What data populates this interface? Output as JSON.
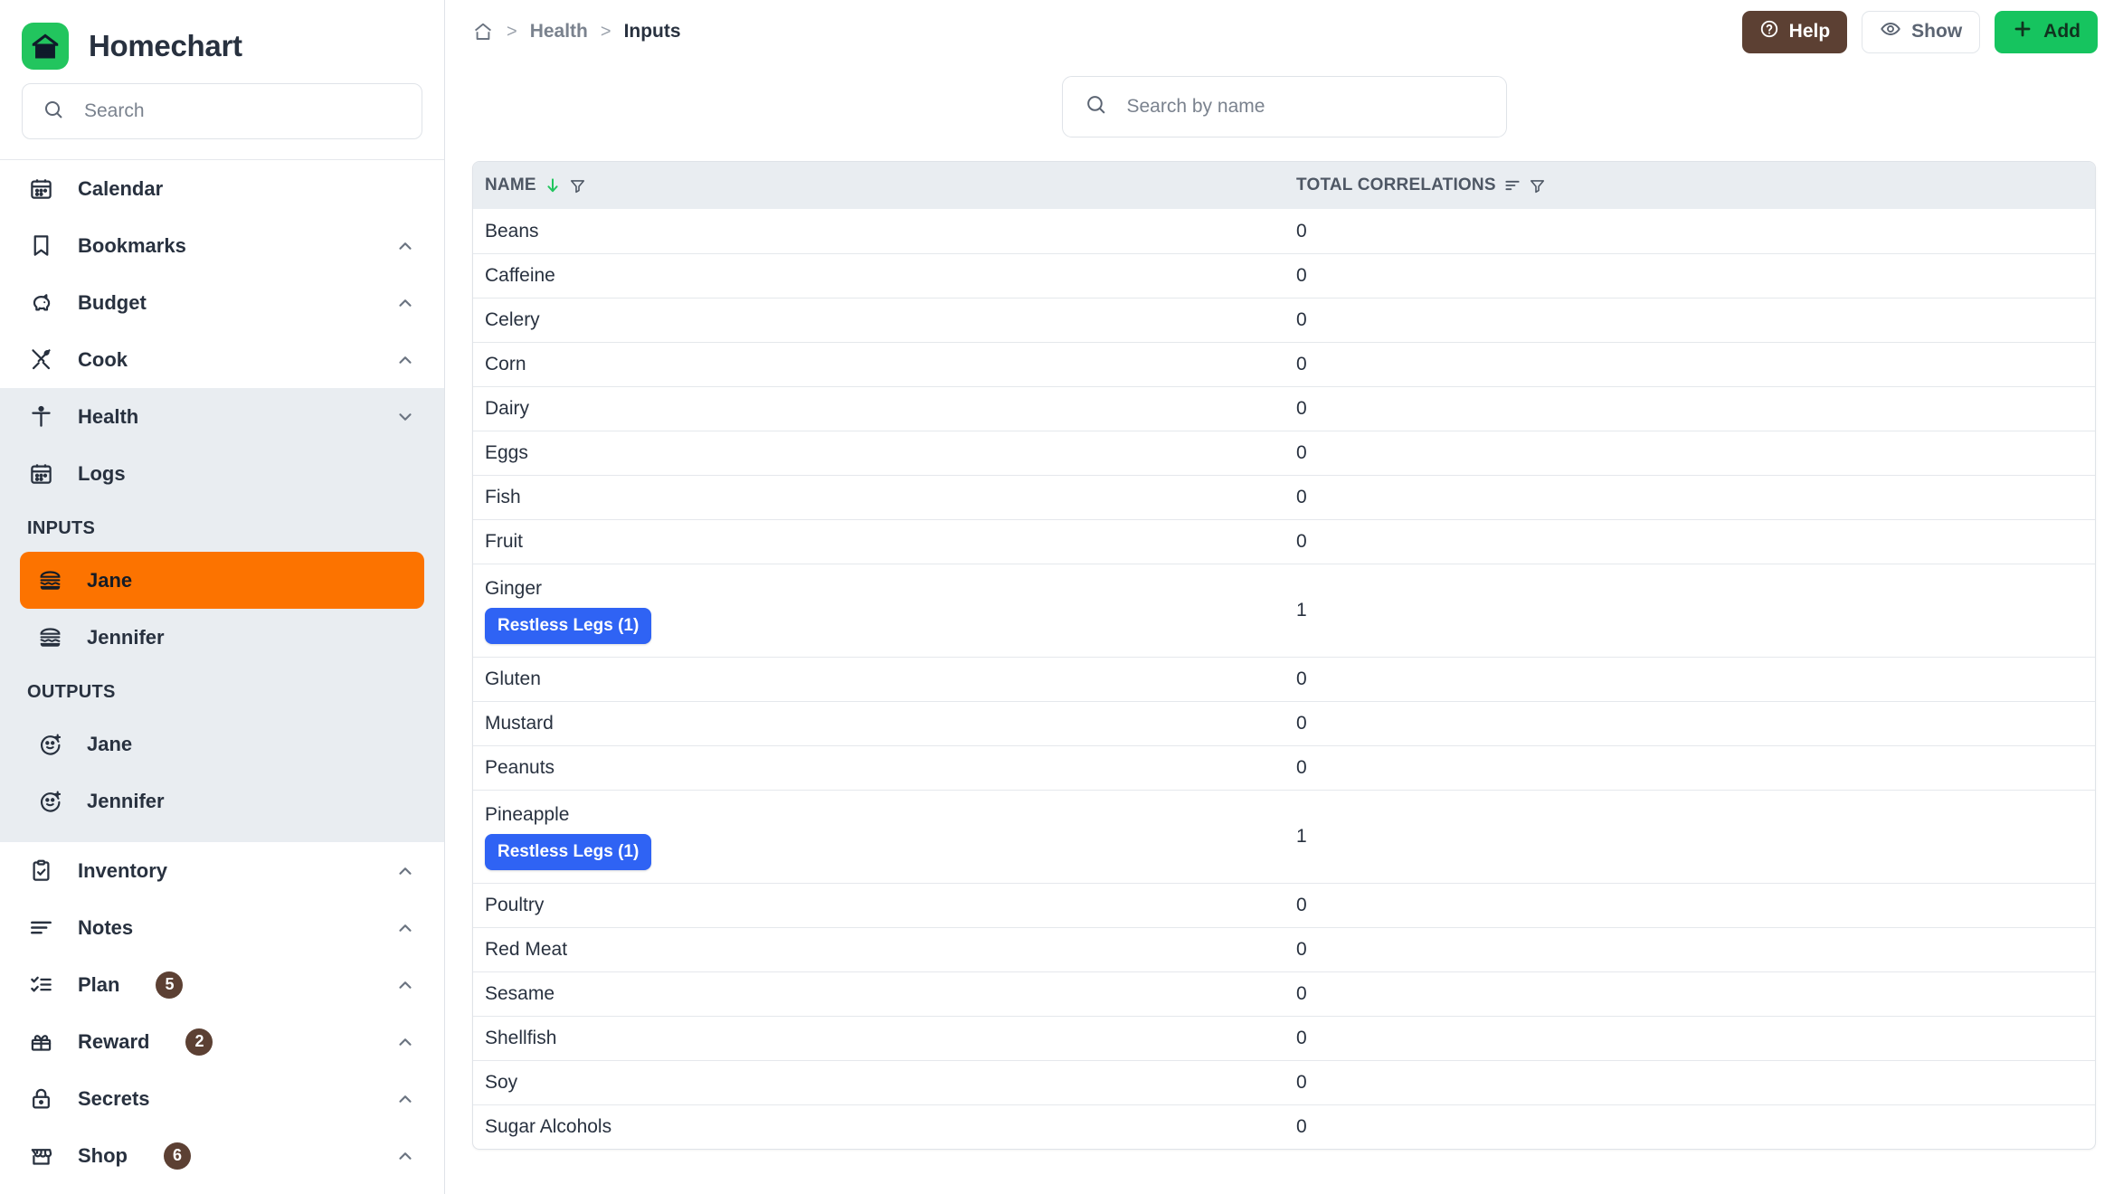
{
  "brand": {
    "title": "Homechart",
    "logo_icon": "home-chart-logo-icon",
    "accent_green": "#22c55e"
  },
  "sidebar": {
    "search": {
      "placeholder": "Search",
      "value": "",
      "icon": "search-icon"
    },
    "items_top": [
      {
        "label": "Calendar",
        "icon": "calendar-icon",
        "chevron": ""
      },
      {
        "label": "Bookmarks",
        "icon": "bookmark-icon",
        "chevron": "chevron-up-icon"
      },
      {
        "label": "Budget",
        "icon": "piggy-bank-icon",
        "chevron": "chevron-up-icon"
      },
      {
        "label": "Cook",
        "icon": "fork-spoon-icon",
        "chevron": "chevron-up-icon"
      }
    ],
    "health": {
      "label": "Health",
      "icon": "accessibility-person-icon",
      "chevron": "chevron-down-icon",
      "logs": {
        "label": "Logs",
        "icon": "calendar-icon"
      },
      "inputs_header": "INPUTS",
      "inputs": [
        {
          "label": "Jane",
          "icon": "burger-icon",
          "active": true
        },
        {
          "label": "Jennifer",
          "icon": "burger-icon",
          "active": false
        }
      ],
      "outputs_header": "OUTPUTS",
      "outputs": [
        {
          "label": "Jane",
          "icon": "mood-face-icon",
          "active": false
        },
        {
          "label": "Jennifer",
          "icon": "mood-face-icon",
          "active": false
        }
      ]
    },
    "items_bottom": [
      {
        "label": "Inventory",
        "icon": "clipboard-check-icon",
        "chevron": "chevron-up-icon",
        "badge": ""
      },
      {
        "label": "Notes",
        "icon": "text-lines-icon",
        "chevron": "chevron-up-icon",
        "badge": ""
      },
      {
        "label": "Plan",
        "icon": "checklist-icon",
        "chevron": "chevron-up-icon",
        "badge": "5"
      },
      {
        "label": "Reward",
        "icon": "gift-icon",
        "chevron": "chevron-up-icon",
        "badge": "2"
      },
      {
        "label": "Secrets",
        "icon": "lock-icon",
        "chevron": "chevron-up-icon",
        "badge": ""
      },
      {
        "label": "Shop",
        "icon": "store-icon",
        "chevron": "chevron-up-icon",
        "badge": "6"
      }
    ],
    "active_accent": "#fc7300",
    "badge_color": "#5c4033"
  },
  "topbar": {
    "breadcrumb": {
      "home_icon": "home-icon",
      "sep": ">",
      "link": "Health",
      "current": "Inputs"
    },
    "buttons": {
      "help": {
        "label": "Help",
        "icon": "question-circle-icon",
        "color": "#5c4033"
      },
      "show": {
        "label": "Show",
        "icon": "eye-icon"
      },
      "add": {
        "label": "Add",
        "icon": "plus-icon",
        "color": "#16c45f"
      }
    }
  },
  "table": {
    "search": {
      "placeholder": "Search by name",
      "value": "",
      "icon": "search-icon"
    },
    "columns": [
      {
        "label": "NAME",
        "sort_icon": "arrow-down-icon",
        "sorted": true,
        "filter_icon": "filter-icon"
      },
      {
        "label": "TOTAL CORRELATIONS",
        "sort_icon": "sort-icon",
        "sorted": false,
        "filter_icon": "filter-icon"
      }
    ],
    "rows": [
      {
        "name": "Beans",
        "correlations": "0",
        "tags": []
      },
      {
        "name": "Caffeine",
        "correlations": "0",
        "tags": []
      },
      {
        "name": "Celery",
        "correlations": "0",
        "tags": []
      },
      {
        "name": "Corn",
        "correlations": "0",
        "tags": []
      },
      {
        "name": "Dairy",
        "correlations": "0",
        "tags": []
      },
      {
        "name": "Eggs",
        "correlations": "0",
        "tags": []
      },
      {
        "name": "Fish",
        "correlations": "0",
        "tags": []
      },
      {
        "name": "Fruit",
        "correlations": "0",
        "tags": []
      },
      {
        "name": "Ginger",
        "correlations": "1",
        "tags": [
          "Restless Legs (1)"
        ]
      },
      {
        "name": "Gluten",
        "correlations": "0",
        "tags": []
      },
      {
        "name": "Mustard",
        "correlations": "0",
        "tags": []
      },
      {
        "name": "Peanuts",
        "correlations": "0",
        "tags": []
      },
      {
        "name": "Pineapple",
        "correlations": "1",
        "tags": [
          "Restless Legs (1)"
        ]
      },
      {
        "name": "Poultry",
        "correlations": "0",
        "tags": []
      },
      {
        "name": "Red Meat",
        "correlations": "0",
        "tags": []
      },
      {
        "name": "Sesame",
        "correlations": "0",
        "tags": []
      },
      {
        "name": "Shellfish",
        "correlations": "0",
        "tags": []
      },
      {
        "name": "Soy",
        "correlations": "0",
        "tags": []
      },
      {
        "name": "Sugar Alcohols",
        "correlations": "0",
        "tags": []
      }
    ],
    "tag_color": "#2f63f4"
  }
}
